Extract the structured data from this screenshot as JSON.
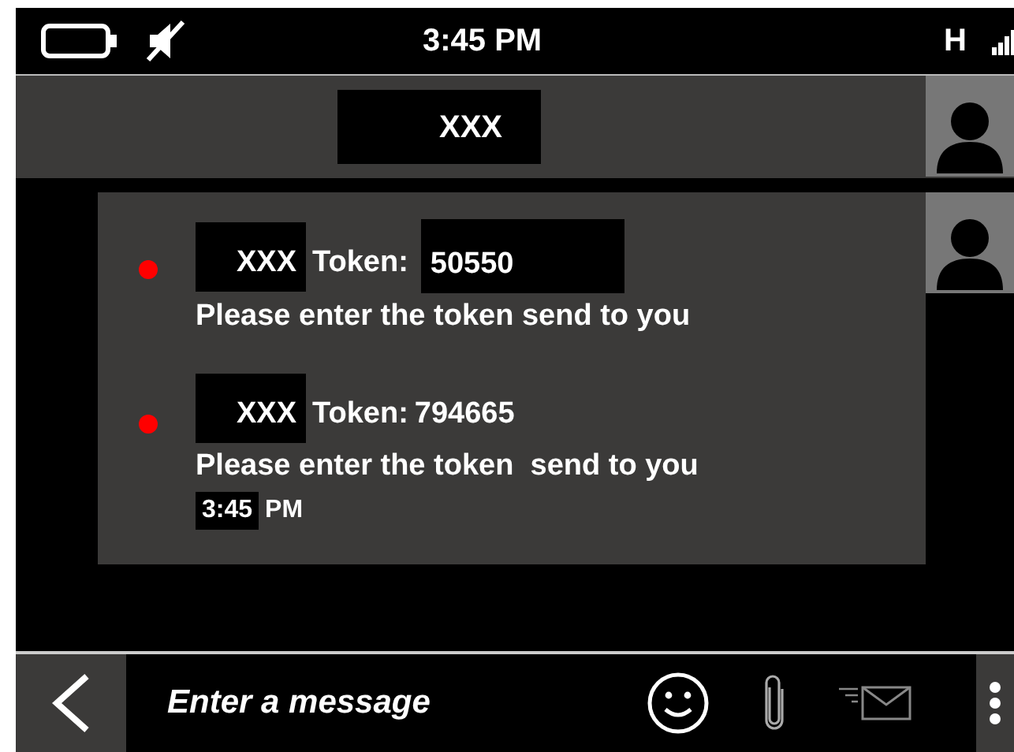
{
  "status_bar": {
    "time": "3:45 PM",
    "network": "H"
  },
  "header": {
    "contact": "XXX"
  },
  "messages": [
    {
      "unread": true,
      "sender": "XXX",
      "label": "Token:",
      "token": "50550",
      "token_highlighted": true,
      "text": "Please enter the token send to you"
    },
    {
      "unread": true,
      "sender": "XXX",
      "label": "Token:",
      "token": "794665",
      "token_highlighted": false,
      "text": "Please enter the token  send to you"
    }
  ],
  "timestamp": {
    "time": "3:45",
    "suffix": "PM"
  },
  "composer": {
    "placeholder": "Enter a message"
  }
}
